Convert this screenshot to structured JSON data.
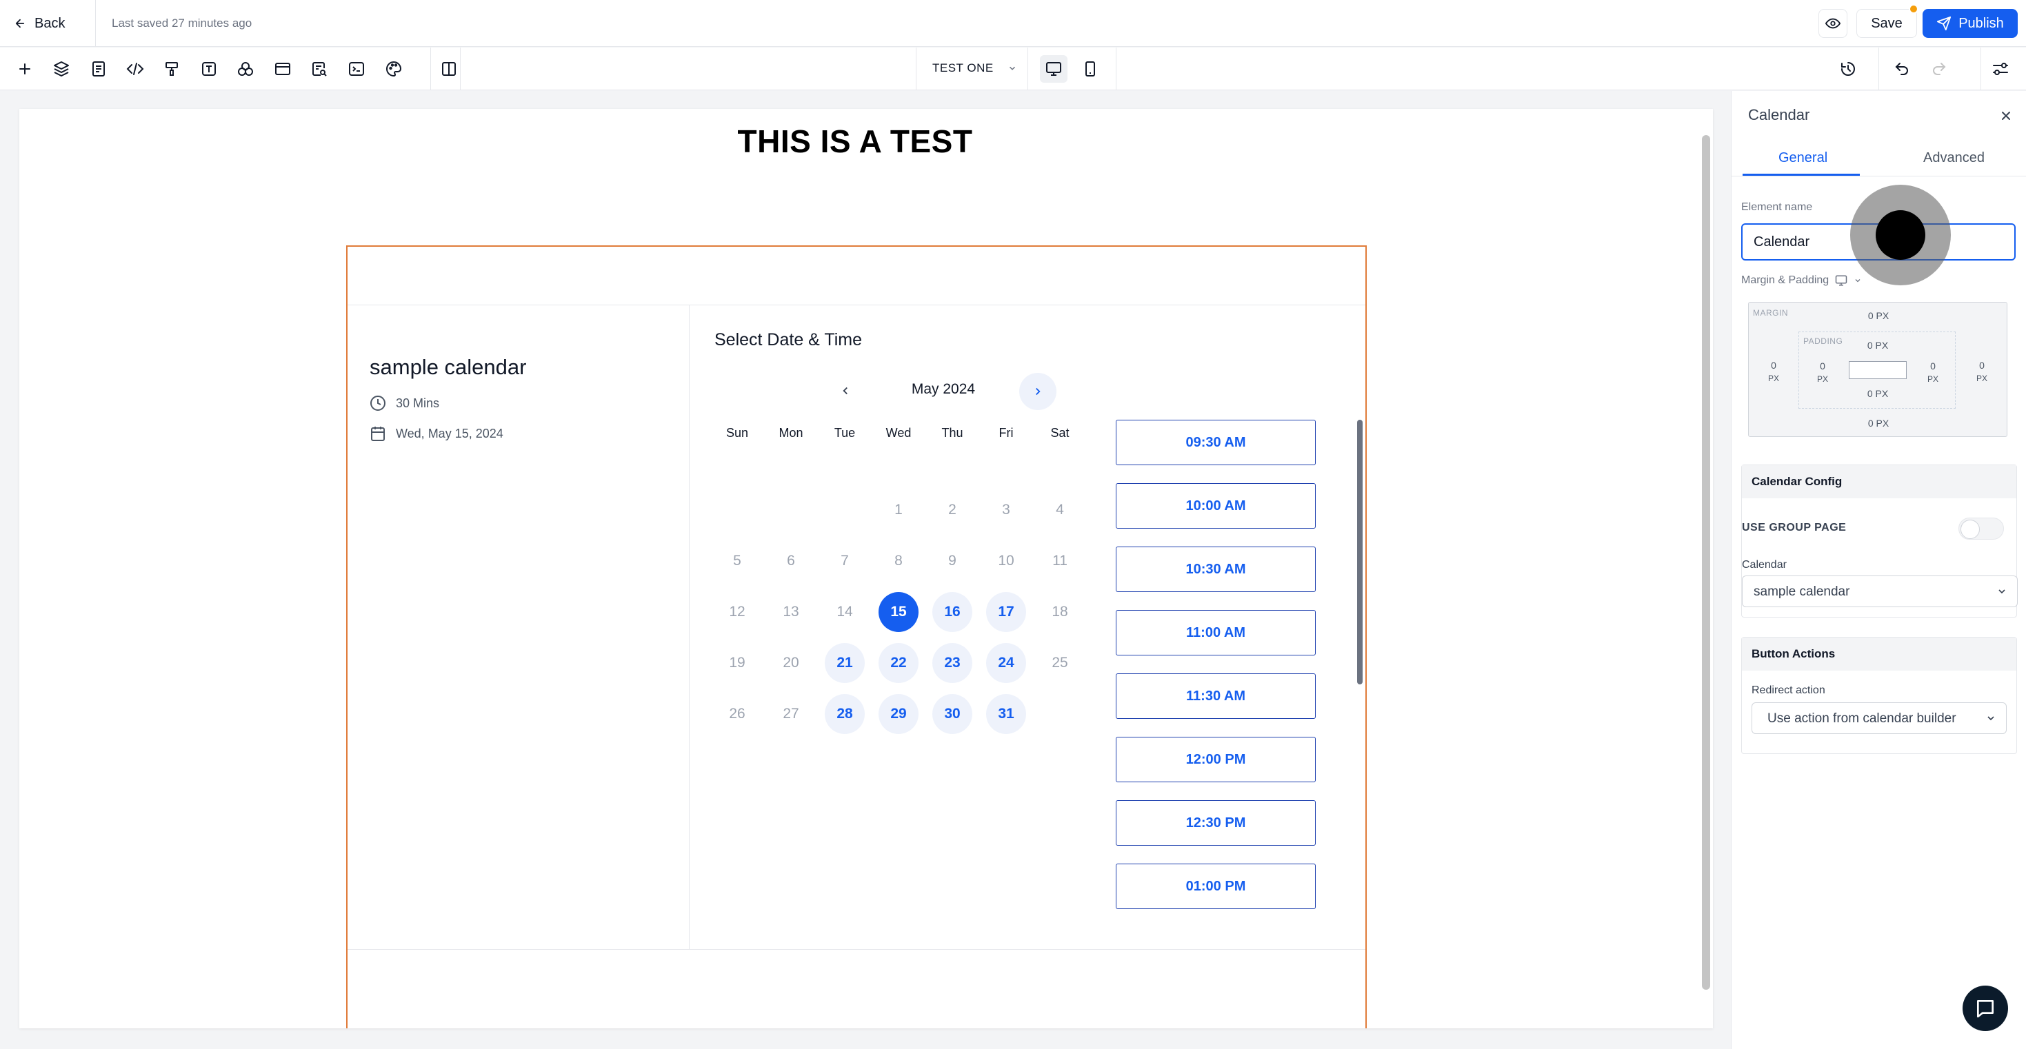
{
  "topbar": {
    "back_label": "Back",
    "last_saved": "Last saved 27 minutes ago",
    "save_label": "Save",
    "publish_label": "Publish"
  },
  "toolbar": {
    "tools": [
      "plus-icon",
      "layers-icon",
      "page-icon",
      "code-icon",
      "paint-roller-icon",
      "text-icon",
      "shapes-icon",
      "section-icon",
      "search-doc-icon",
      "terminal-icon",
      "palette-icon",
      "columns-icon"
    ],
    "page_name": "TEST ONE"
  },
  "canvas": {
    "heading": "THIS IS A TEST",
    "calendar": {
      "event_name": "sample calendar",
      "duration": "30 Mins",
      "selected_date_text": "Wed, May 15, 2024",
      "select_title": "Select Date & Time",
      "month": "May 2024",
      "weekdays": [
        "Sun",
        "Mon",
        "Tue",
        "Wed",
        "Thu",
        "Fri",
        "Sat"
      ],
      "weeks": [
        [
          null,
          null,
          null,
          1,
          2,
          3,
          4
        ],
        [
          5,
          6,
          7,
          8,
          9,
          10,
          11
        ],
        [
          12,
          13,
          14,
          15,
          16,
          17,
          18
        ],
        [
          19,
          20,
          21,
          22,
          23,
          24,
          25
        ],
        [
          26,
          27,
          28,
          29,
          30,
          31,
          null
        ]
      ],
      "available_days": [
        16,
        17,
        21,
        22,
        23,
        24,
        28,
        29,
        30,
        31
      ],
      "selected_day": 15,
      "time_slots": [
        "09:30 AM",
        "10:00 AM",
        "10:30 AM",
        "11:00 AM",
        "11:30 AM",
        "12:00 PM",
        "12:30 PM",
        "01:00 PM"
      ]
    }
  },
  "panel": {
    "title": "Calendar",
    "tabs": [
      "General",
      "Advanced"
    ],
    "element_name_label": "Element name",
    "element_name_value": "Calendar",
    "margin_padding_label": "Margin & Padding",
    "spacing": {
      "margin_label": "MARGIN",
      "padding_label": "PADDING",
      "margin_top": "0 PX",
      "margin_bottom": "0 PX",
      "margin_left": "0",
      "margin_right": "0",
      "padding_top": "0 PX",
      "padding_bottom": "0 PX",
      "padding_left": "0",
      "padding_right": "0",
      "unit": "PX"
    },
    "calendar_config": {
      "header": "Calendar Config",
      "use_group_page_label": "USE GROUP PAGE",
      "calendar_label": "Calendar",
      "calendar_value": "sample calendar"
    },
    "button_actions": {
      "header": "Button Actions",
      "redirect_label": "Redirect action",
      "redirect_value": "Use action from calendar builder"
    }
  },
  "colors": {
    "primary": "#155eef",
    "section_border": "#e07b39",
    "notification": "#f59e0b"
  }
}
